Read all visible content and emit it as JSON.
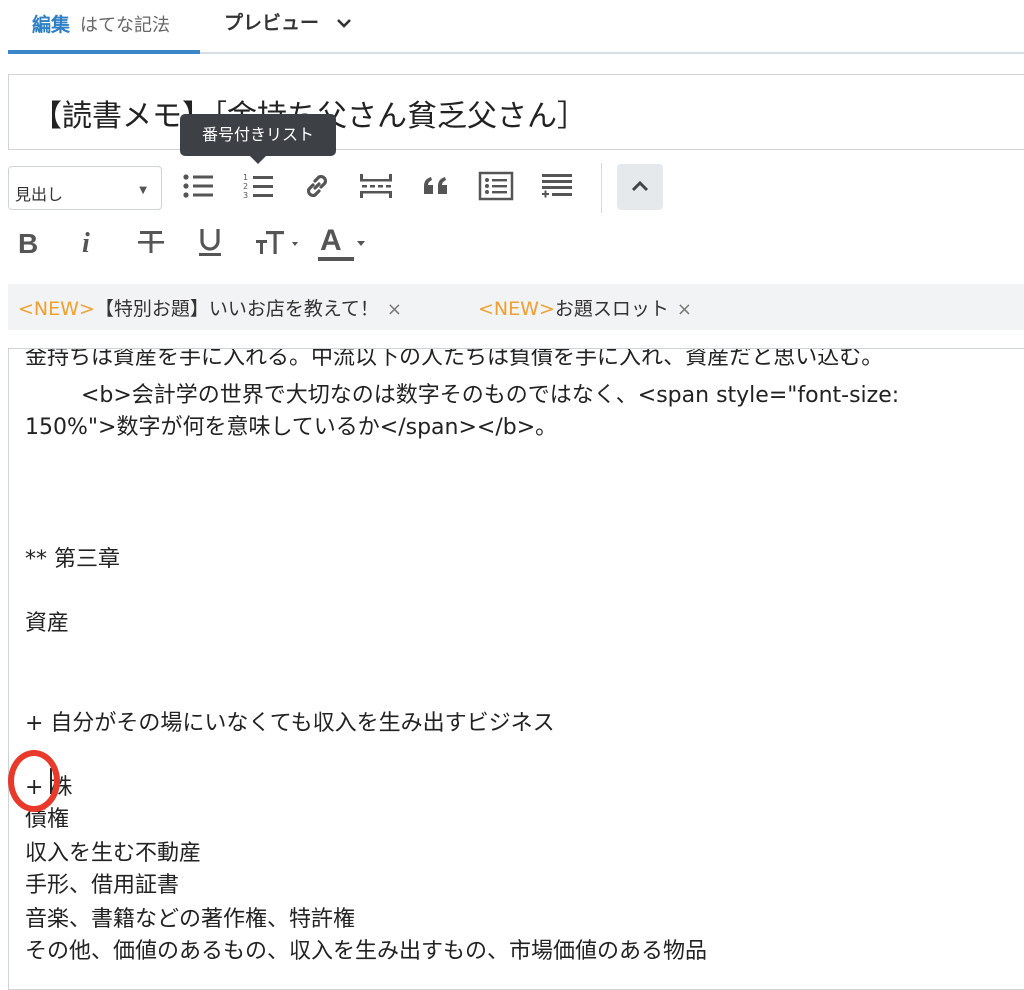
{
  "tabs": {
    "edit_label": "編集",
    "edit_mode": "はてな記法",
    "preview_label": "プレビュー",
    "preview_chevron": "chevron-down-icon"
  },
  "title": "【読書メモ】［金持ち父さん貧乏父さん］",
  "tooltip": "番号付きリスト",
  "toolbar": {
    "heading_select": "見出し",
    "icons": [
      "bulleted-list-icon",
      "numbered-list-icon",
      "link-icon",
      "more-break-icon",
      "quote-icon",
      "table-of-contents-icon",
      "footnote-icon",
      "collapse-icon"
    ],
    "format_icons": [
      "bold-icon",
      "italic-icon",
      "strikethrough-icon",
      "underline-icon",
      "font-size-icon",
      "font-color-icon"
    ],
    "bold": "B",
    "italic": "i",
    "color_letter": "A"
  },
  "notices": [
    {
      "tag": "<NEW>",
      "text": "【特別お題】いいお店を教えて！",
      "close": "×"
    },
    {
      "tag": "<NEW>",
      "text": "お題スロット",
      "close": "×"
    }
  ],
  "editor": {
    "lines": [
      "金持ちは資産を手に入れる。中流以下の人たちは負債を手に入れ、資産だと思い込む。",
      "\t<b>会計学の世界で大切なのは数字そのものではなく、<span style=\"font-size:",
      "150%\">数字が何を意味しているか</span></b>。",
      "** 第三章",
      "資産",
      "+ 自分がその場にいなくても収入を生み出すビジネス",
      "+ 株",
      "債権",
      "収入を生む不動産",
      "手形、借用証書",
      "音楽、書籍などの著作権、特許権",
      "その他、価値のあるもの、収入を生み出すもの、市場価値のある物品"
    ]
  },
  "colors": {
    "accent": "#3a86c8",
    "new_tag": "#f0a030",
    "highlight_circle": "#e8392a"
  }
}
